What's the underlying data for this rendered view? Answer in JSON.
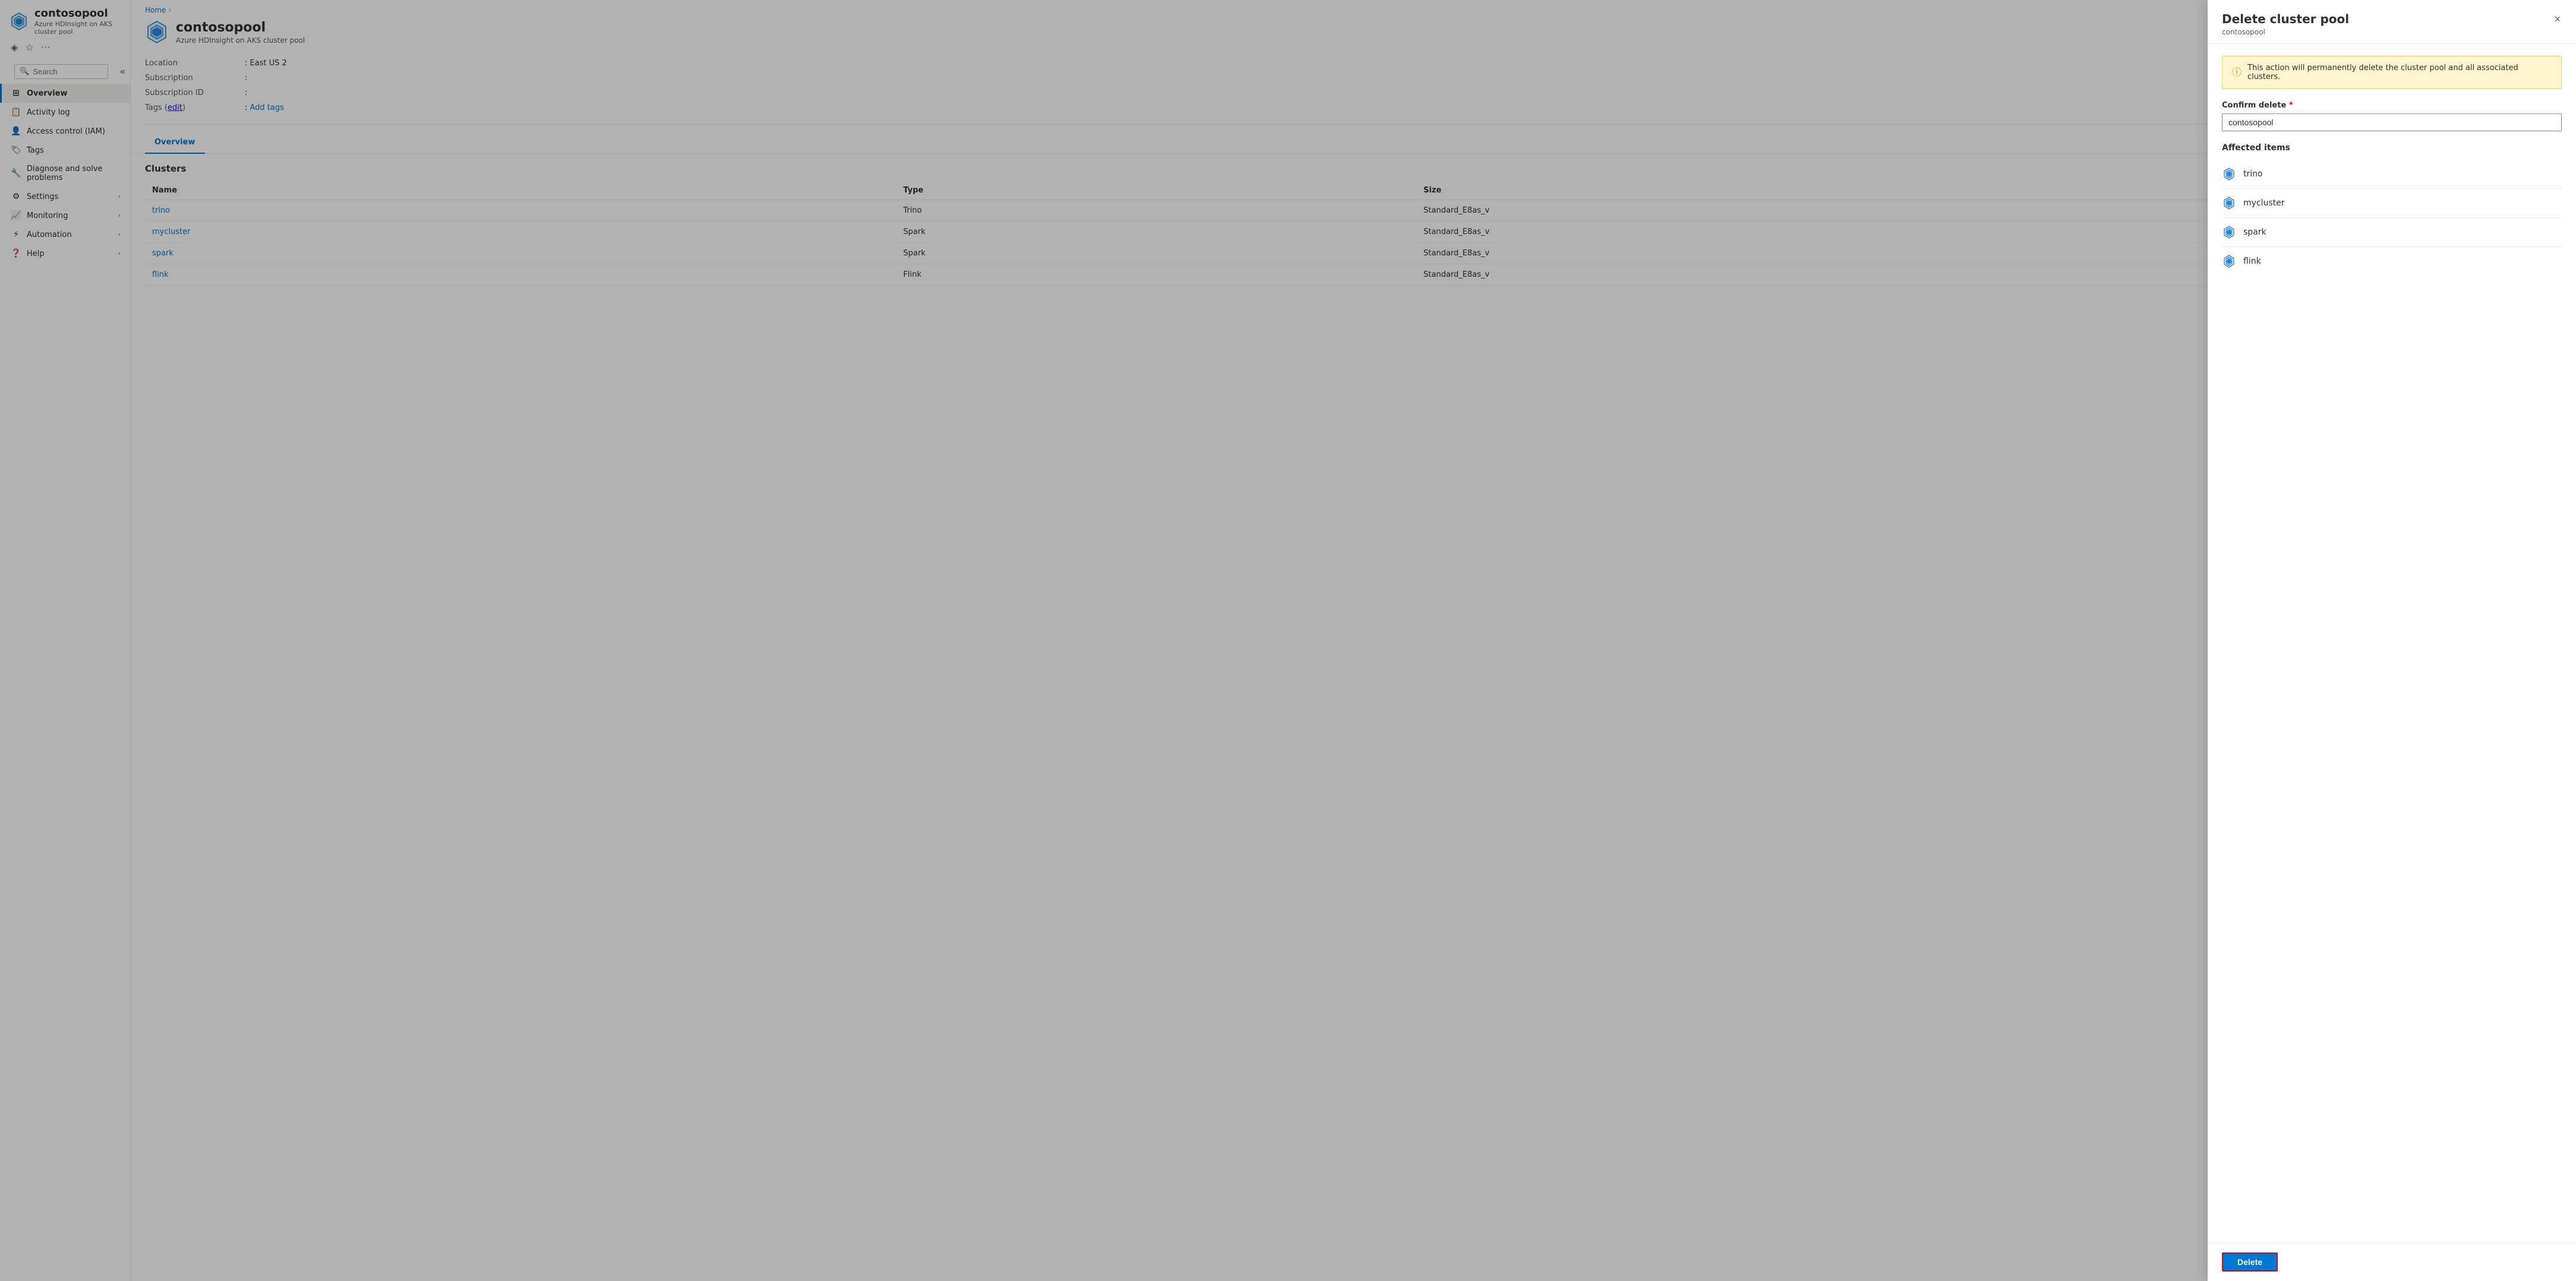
{
  "breadcrumb": {
    "home": "Home"
  },
  "sidebar": {
    "app_title": "contosopool",
    "app_subtitle": "Azure HDInsight on AKS cluster pool",
    "search_placeholder": "Search",
    "nav_items": [
      {
        "id": "overview",
        "label": "Overview",
        "icon": "grid",
        "active": true,
        "expandable": false
      },
      {
        "id": "activity-log",
        "label": "Activity log",
        "icon": "list",
        "active": false,
        "expandable": false
      },
      {
        "id": "access-control",
        "label": "Access control (IAM)",
        "icon": "person",
        "active": false,
        "expandable": false
      },
      {
        "id": "tags",
        "label": "Tags",
        "icon": "tag",
        "active": false,
        "expandable": false
      },
      {
        "id": "diagnose",
        "label": "Diagnose and solve problems",
        "icon": "wrench",
        "active": false,
        "expandable": false
      },
      {
        "id": "settings",
        "label": "Settings",
        "icon": "settings",
        "active": false,
        "expandable": true
      },
      {
        "id": "monitoring",
        "label": "Monitoring",
        "icon": "chart",
        "active": false,
        "expandable": true
      },
      {
        "id": "automation",
        "label": "Automation",
        "icon": "automation",
        "active": false,
        "expandable": true
      },
      {
        "id": "help",
        "label": "Help",
        "icon": "help",
        "active": false,
        "expandable": true
      }
    ]
  },
  "main": {
    "title": "contosopool",
    "subtitle": "Azure HDInsight on AKS cluster pool",
    "info": {
      "location_label": "Location",
      "location_value": "East US 2",
      "subscription_label": "Subscription",
      "subscription_value": "",
      "subscription_id_label": "Subscription ID",
      "subscription_id_value": "",
      "tags_label": "Tags (edit)",
      "tags_link": "edit",
      "add_tags_label": "Add tags"
    },
    "tab": "Overview",
    "clusters_title": "Clusters",
    "table": {
      "columns": [
        "Name",
        "Type",
        "Size"
      ],
      "rows": [
        {
          "name": "trino",
          "type": "Trino",
          "size": "Standard_E8as_v"
        },
        {
          "name": "mycluster",
          "type": "Spark",
          "size": "Standard_E8as_v"
        },
        {
          "name": "spark",
          "type": "Spark",
          "size": "Standard_E8as_v"
        },
        {
          "name": "flink",
          "type": "Flink",
          "size": "Standard_E8as_v"
        }
      ]
    }
  },
  "panel": {
    "title": "Delete cluster pool",
    "subtitle": "contosopool",
    "close_label": "×",
    "warning_text": "This action will permanently delete the cluster pool and all associated clusters.",
    "confirm_label": "Confirm delete",
    "confirm_value": "contosopool",
    "affected_title": "Affected items",
    "affected_items": [
      {
        "name": "trino"
      },
      {
        "name": "mycluster"
      },
      {
        "name": "spark"
      },
      {
        "name": "flink"
      }
    ],
    "delete_button": "Delete"
  }
}
